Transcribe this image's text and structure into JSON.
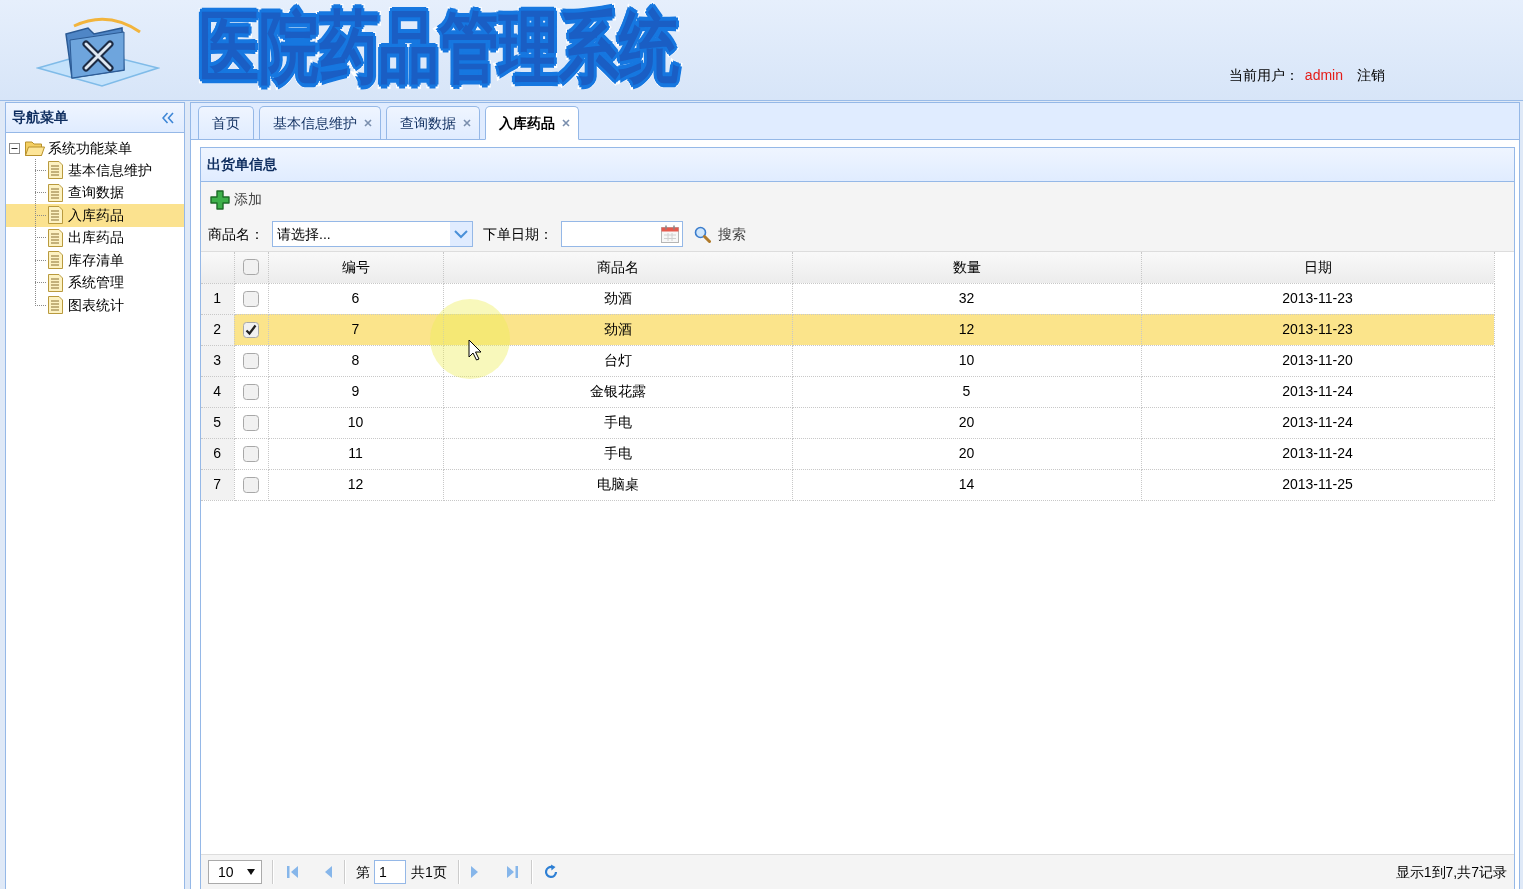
{
  "header": {
    "title": "医院药品管理系统",
    "user_label": "当前用户：",
    "user_name": "admin",
    "logout": "注销"
  },
  "sidebar": {
    "title": "导航菜单",
    "tree": [
      {
        "label": "系统功能菜单",
        "expanded": true,
        "children": [
          {
            "label": "基本信息维护",
            "selected": false
          },
          {
            "label": "查询数据",
            "selected": false
          },
          {
            "label": "入库药品",
            "selected": true
          },
          {
            "label": "出库药品",
            "selected": false
          },
          {
            "label": "库存清单",
            "selected": false
          },
          {
            "label": "系统管理",
            "selected": false
          },
          {
            "label": "图表统计",
            "selected": false
          }
        ]
      }
    ]
  },
  "tabs": [
    {
      "label": "首页",
      "closable": false,
      "selected": false
    },
    {
      "label": "基本信息维护",
      "closable": true,
      "selected": false
    },
    {
      "label": "查询数据",
      "closable": true,
      "selected": false
    },
    {
      "label": "入库药品",
      "closable": true,
      "selected": true
    }
  ],
  "panel": {
    "title": "出货单信息",
    "add_button": "添加",
    "search": {
      "product_label": "商品名：",
      "product_value": "请选择...",
      "date_label": "下单日期：",
      "button": "搜索"
    }
  },
  "table": {
    "all_checked": false,
    "columns": [
      "编号",
      "商品名",
      "数量",
      "日期"
    ],
    "rows": [
      {
        "number": "1",
        "checked": false,
        "selected": false,
        "cells": [
          "6",
          "劲酒",
          "32",
          "2013-11-23"
        ]
      },
      {
        "number": "2",
        "checked": true,
        "selected": true,
        "cells": [
          "7",
          "劲酒",
          "12",
          "2013-11-23"
        ]
      },
      {
        "number": "3",
        "checked": false,
        "selected": false,
        "cells": [
          "8",
          "台灯",
          "10",
          "2013-11-20"
        ]
      },
      {
        "number": "4",
        "checked": false,
        "selected": false,
        "cells": [
          "9",
          "金银花露",
          "5",
          "2013-11-24"
        ]
      },
      {
        "number": "5",
        "checked": false,
        "selected": false,
        "cells": [
          "10",
          "手电",
          "20",
          "2013-11-24"
        ]
      },
      {
        "number": "6",
        "checked": false,
        "selected": false,
        "cells": [
          "11",
          "手电",
          "20",
          "2013-11-24"
        ]
      },
      {
        "number": "7",
        "checked": false,
        "selected": false,
        "cells": [
          "12",
          "电脑桌",
          "14",
          "2013-11-25"
        ]
      }
    ]
  },
  "pager": {
    "page_size": "10",
    "page_prefix": "第",
    "page": "1",
    "page_total": "共1页",
    "summary": "显示1到7,共7记录"
  }
}
